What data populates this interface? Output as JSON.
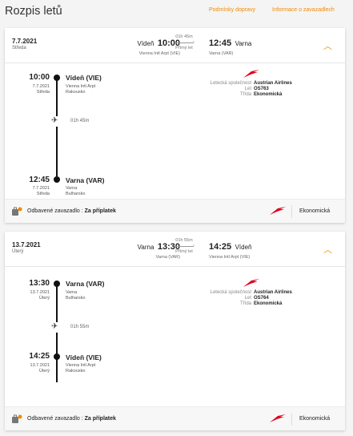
{
  "page": {
    "title": "Rozpis letů",
    "links": [
      "Podmínky dopravy",
      "Informace o zavazadlech"
    ]
  },
  "labels": {
    "carrier_label": "Letecká společnost",
    "flight_label": "Let",
    "class_label": "Třída",
    "baggage_label": "Odbavené zavazadlo :",
    "baggage_value": "Za příplatek"
  },
  "colors": {
    "accent": "#f08a00",
    "austrian_red": "#e2001a"
  },
  "flights": [
    {
      "date": "7.7.2021",
      "day": "Středa",
      "dep_city": "Vídeň",
      "dep_time": "10:00",
      "dep_airport": "Vienna Intl Arpt (VIE)",
      "duration": "01h 45m",
      "direct": "Přímý let",
      "arr_time": "12:45",
      "arr_city": "Varna",
      "arr_airport": "Varna (VAR)",
      "origin": {
        "time": "10:00",
        "date": "7.7.2021",
        "day": "Středa",
        "name": "Vídeň (VIE)",
        "airport": "Vienna Intl Arpt",
        "country": "Rakousko"
      },
      "destination": {
        "time": "12:45",
        "date": "7.7.2021",
        "day": "Středa",
        "name": "Varna (VAR)",
        "airport": "Varna",
        "country": "Bulharsko"
      },
      "seg_duration": "01h 45m",
      "carrier": "Austrian Airlines",
      "flight_no": "OS763",
      "cabin": "Ekonomická",
      "footer_class": "Ekonomická"
    },
    {
      "date": "13.7.2021",
      "day": "Úterý",
      "dep_city": "Varna",
      "dep_time": "13:30",
      "dep_airport": "Varna (VAR)",
      "duration": "01h 55m",
      "direct": "Přímý let",
      "arr_time": "14:25",
      "arr_city": "Vídeň",
      "arr_airport": "Vienna Intl Arpt (VIE)",
      "origin": {
        "time": "13:30",
        "date": "13.7.2021",
        "day": "Úterý",
        "name": "Varna (VAR)",
        "airport": "Varna",
        "country": "Bulharsko"
      },
      "destination": {
        "time": "14:25",
        "date": "13.7.2021",
        "day": "Úterý",
        "name": "Vídeň (VIE)",
        "airport": "Vienna Intl Arpt",
        "country": "Rakousko"
      },
      "seg_duration": "01h 55m",
      "carrier": "Austrian Airlines",
      "flight_no": "OS764",
      "cabin": "Ekonomická",
      "footer_class": "Ekonomická"
    }
  ]
}
